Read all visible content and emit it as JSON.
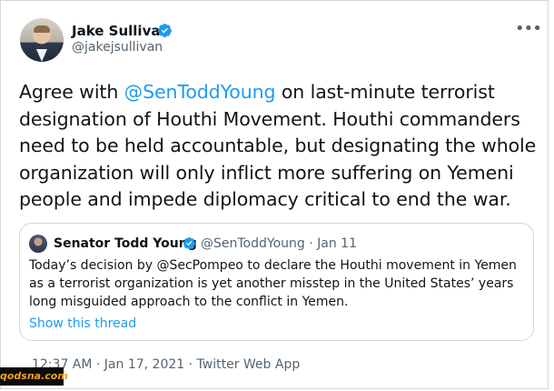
{
  "author": {
    "name": "Jake Sullivan",
    "handle": "@jakejsullivan",
    "verified_icon": "verified-badge-icon"
  },
  "menu_icon": "more-options-icon",
  "tweet": {
    "prefix": "Agree with ",
    "mention": "@SenToddYoung",
    "text": " on last-minute terrorist designation of Houthi Movement. Houthi commanders need to be held accountable, but designating the whole organization will only inflict more suffering on Yemeni people and impede diplomacy critical to end the war."
  },
  "quoted": {
    "name": "Senator Todd Young",
    "handle_date": "@SenToddYoung · Jan 11",
    "text": "Today’s decision by @SecPompeo to declare the Houthi movement in Yemen as a terrorist organization is yet another misstep in the United States’ years long misguided approach to the conflict in Yemen.",
    "show_thread": "Show this thread"
  },
  "meta": "12:37 AM · Jan 17, 2021 · Twitter Web App",
  "watermark": "qodsna.com",
  "colors": {
    "accent": "#1d9bf0",
    "text": "#0f1419",
    "muted": "#536471",
    "border": "#cfd9de"
  }
}
